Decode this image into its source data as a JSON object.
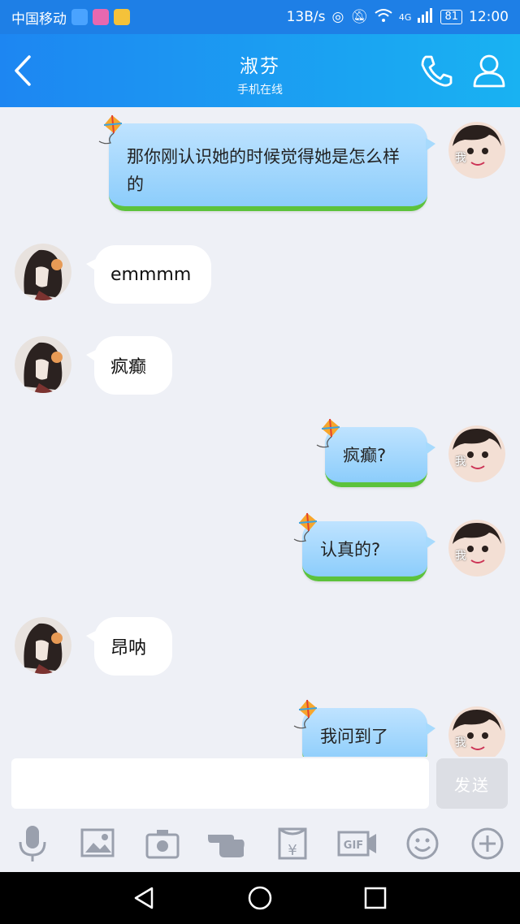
{
  "status_bar": {
    "carrier": "中国移动",
    "speed": "13B/s",
    "network": "4G",
    "battery": "81",
    "time": "12:00"
  },
  "header": {
    "title": "淑芬",
    "subtitle": "手机在线"
  },
  "messages": [
    {
      "from": "me",
      "text": "那你刚认识她的时候觉得她是怎么样的",
      "avatar_label": "我"
    },
    {
      "from": "other",
      "text": "emmmm"
    },
    {
      "from": "other",
      "text": "疯癫"
    },
    {
      "from": "me",
      "text": "疯癫?",
      "avatar_label": "我"
    },
    {
      "from": "me",
      "text": "认真的?",
      "avatar_label": "我"
    },
    {
      "from": "other",
      "text": "昂呐"
    },
    {
      "from": "me",
      "text": "我问到了",
      "avatar_label": "我"
    }
  ],
  "composer": {
    "placeholder": "",
    "value": "",
    "send_label": "发送"
  },
  "toolbar": {
    "gif_label": "GIF",
    "redpacket_label": "¥"
  },
  "colors": {
    "brand": "#1e7fe6",
    "bubble_out": "#a7dafd",
    "grass": "#5cc23c",
    "chat_bg": "#eef0f6"
  }
}
